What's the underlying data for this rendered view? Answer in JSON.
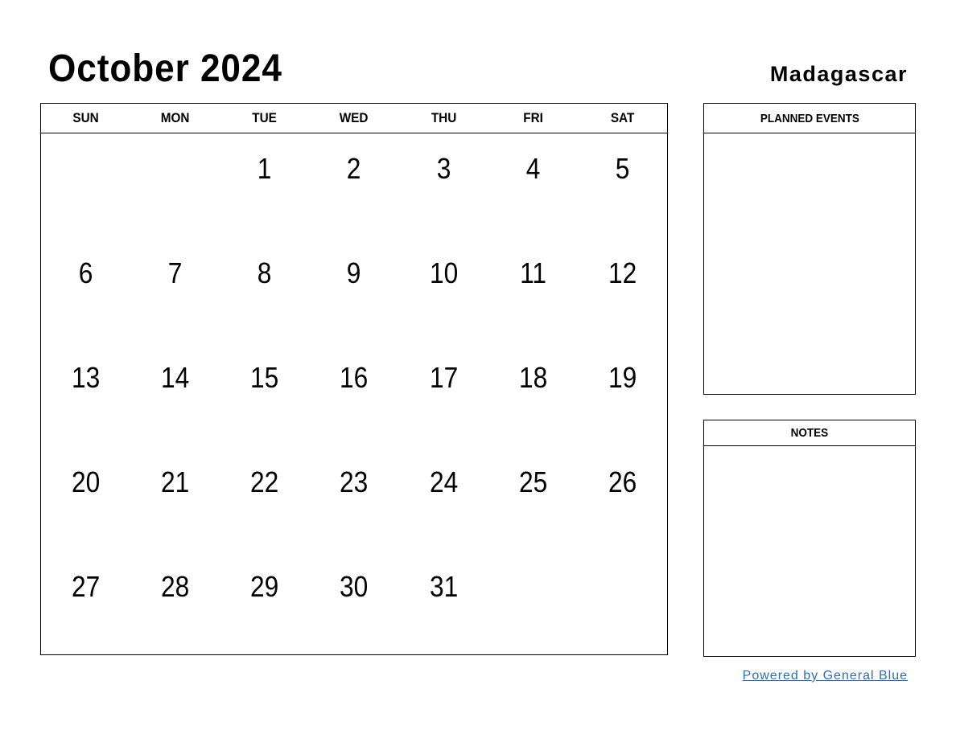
{
  "header": {
    "title": "October 2024",
    "country": "Madagascar"
  },
  "calendar": {
    "weekdays": [
      "SUN",
      "MON",
      "TUE",
      "WED",
      "THU",
      "FRI",
      "SAT"
    ],
    "weeks": [
      [
        "",
        "",
        "1",
        "2",
        "3",
        "4",
        "5"
      ],
      [
        "6",
        "7",
        "8",
        "9",
        "10",
        "11",
        "12"
      ],
      [
        "13",
        "14",
        "15",
        "16",
        "17",
        "18",
        "19"
      ],
      [
        "20",
        "21",
        "22",
        "23",
        "24",
        "25",
        "26"
      ],
      [
        "27",
        "28",
        "29",
        "30",
        "31",
        "",
        ""
      ]
    ]
  },
  "sidebar": {
    "planned_events_label": "PLANNED EVENTS",
    "notes_label": "NOTES"
  },
  "footer": {
    "powered_by": "Powered by General Blue",
    "link_color": "#2a6fba"
  }
}
